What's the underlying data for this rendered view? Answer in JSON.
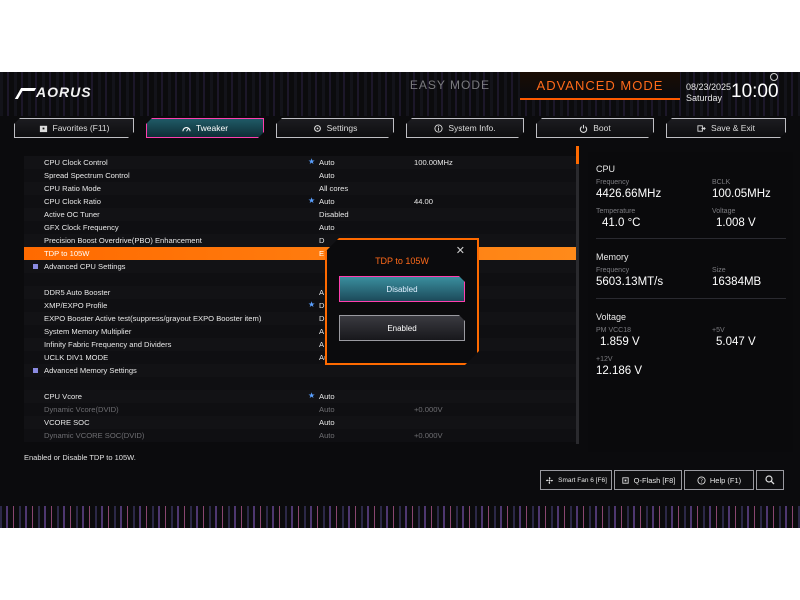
{
  "header": {
    "logo": "AORUS",
    "easy_mode": "EASY MODE",
    "advanced_mode": "ADVANCED MODE",
    "date": "08/23/2025",
    "weekday": "Saturday",
    "time": "10:00"
  },
  "tabs": [
    {
      "label": "Favorites (F11)",
      "icon": "star-folder-icon"
    },
    {
      "label": "Tweaker",
      "icon": "speedometer-icon",
      "active": true
    },
    {
      "label": "Settings",
      "icon": "gear-icon"
    },
    {
      "label": "System Info.",
      "icon": "info-icon"
    },
    {
      "label": "Boot",
      "icon": "power-icon"
    },
    {
      "label": "Save & Exit",
      "icon": "exit-icon"
    }
  ],
  "settings": [
    {
      "label": "CPU Clock Control",
      "star": true,
      "value": "Auto",
      "value2": "100.00MHz"
    },
    {
      "label": "Spread Spectrum Control",
      "value": "Auto"
    },
    {
      "label": "CPU Ratio Mode",
      "value": "All cores"
    },
    {
      "label": "CPU Clock Ratio",
      "star": true,
      "value": "Auto",
      "value2": "44.00"
    },
    {
      "label": "Active OC Tuner",
      "value": "Disabled"
    },
    {
      "label": "GFX Clock Frequency",
      "value": "Auto"
    },
    {
      "label": "Precision Boost Overdrive(PBO) Enhancement",
      "value": "D"
    },
    {
      "label": "TDP to 105W",
      "value": "E",
      "selected": true
    },
    {
      "label": "Advanced CPU Settings",
      "submenu": true
    },
    {
      "label": ""
    },
    {
      "label": "DDR5 Auto Booster",
      "value": "A"
    },
    {
      "label": "XMP/EXPO Profile",
      "star": true,
      "value": "D"
    },
    {
      "label": "EXPO Booster Active test(suppress/grayout EXPO Booster item)",
      "value": "D"
    },
    {
      "label": "System Memory Multiplier",
      "value": "A"
    },
    {
      "label": "Infinity Fabric Frequency and Dividers",
      "value": "A"
    },
    {
      "label": "UCLK DIV1 MODE",
      "value": "Auto"
    },
    {
      "label": "Advanced Memory Settings",
      "submenu": true
    },
    {
      "label": ""
    },
    {
      "label": "CPU Vcore",
      "star": true,
      "value": "Auto"
    },
    {
      "label": "Dynamic Vcore(DVID)",
      "value": "Auto",
      "value2": "+0.000V",
      "dim": true
    },
    {
      "label": "VCORE SOC",
      "value": "Auto"
    },
    {
      "label": "Dynamic VCORE SOC(DVID)",
      "value": "Auto",
      "value2": "+0.000V",
      "dim": true
    }
  ],
  "help_text": "Enabled or Disable TDP to 105W.",
  "bottom_buttons": [
    {
      "label": "Smart Fan 6 [F6]",
      "icon": "fan-icon"
    },
    {
      "label": "Q-Flash [F8]",
      "icon": "chip-icon"
    },
    {
      "label": "Help (F1)",
      "icon": "help-icon"
    },
    {
      "label": "",
      "icon": "search-icon"
    }
  ],
  "dialog": {
    "title": "TDP to 105W",
    "option_disabled": "Disabled",
    "option_enabled": "Enabled"
  },
  "sidebar": {
    "cpu": {
      "title": "CPU",
      "frequency_label": "Frequency",
      "frequency": "4426.66MHz",
      "bclk_label": "BCLK",
      "bclk": "100.05MHz",
      "temperature_label": "Temperature",
      "temperature": "41.0 °C",
      "voltage_label": "Voltage",
      "voltage": "1.008 V"
    },
    "memory": {
      "title": "Memory",
      "frequency_label": "Frequency",
      "frequency": "5603.13MT/s",
      "size_label": "Size",
      "size": "16384MB"
    },
    "voltage": {
      "title": "Voltage",
      "pm_label": "PM VCC18",
      "pm": "1.859 V",
      "p5_label": "+5V",
      "p5": "5.047 V",
      "p12_label": "+12V",
      "p12": "12.186 V"
    }
  }
}
